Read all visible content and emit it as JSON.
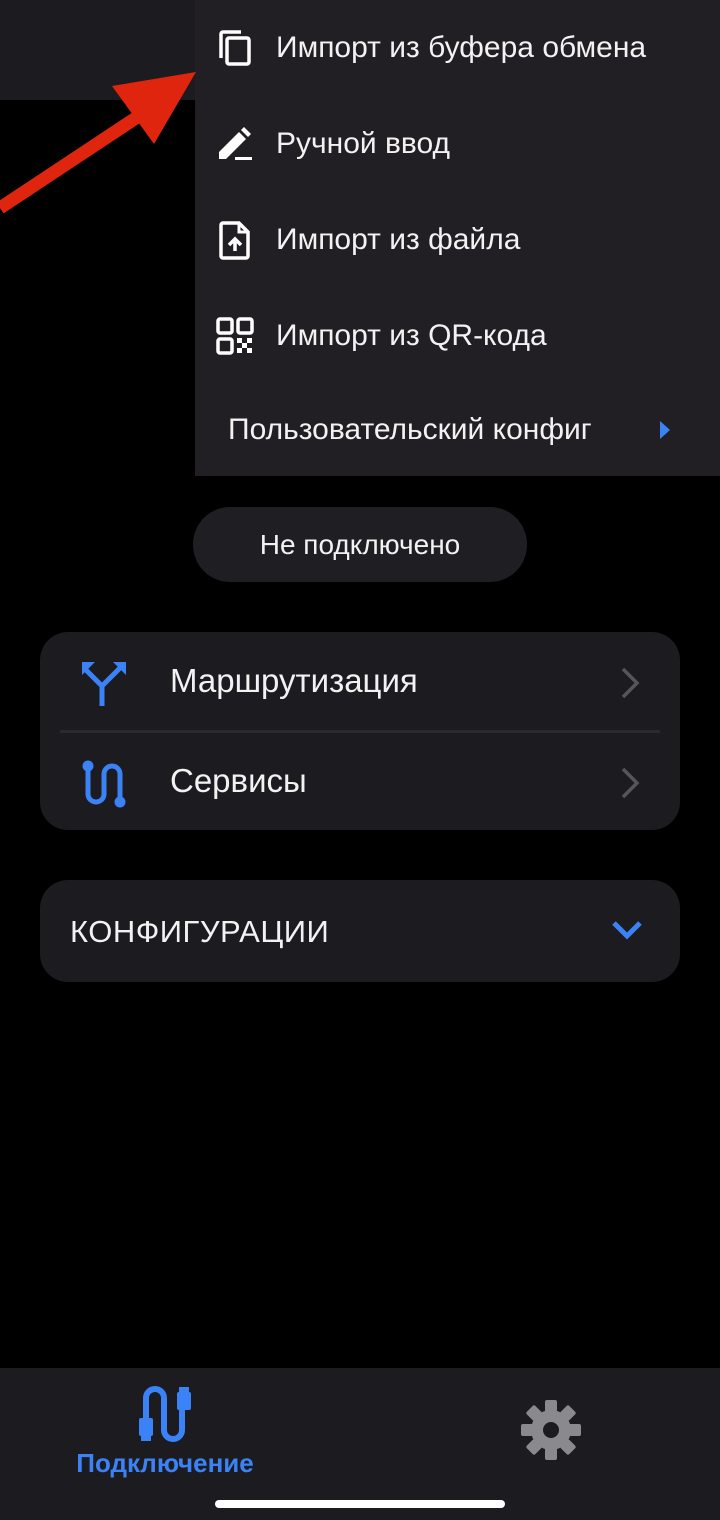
{
  "colors": {
    "accent": "#3b82f6",
    "annotation_arrow": "#e0250f",
    "background": "#000000",
    "surface": "#1c1b1f",
    "menu_surface": "#211f23",
    "inactive_icon": "#8a8a8e"
  },
  "menu": {
    "items": [
      {
        "label": "Импорт из буфера обмена",
        "icon": "copy-icon"
      },
      {
        "label": "Ручной ввод",
        "icon": "edit-pencil-icon"
      },
      {
        "label": "Импорт из файла",
        "icon": "file-upload-icon"
      },
      {
        "label": "Импорт из QR-кода",
        "icon": "qr-code-icon"
      },
      {
        "label": "Пользовательский конфиг",
        "icon": "chevron-right-icon"
      }
    ]
  },
  "status": {
    "label": "Не подключено"
  },
  "routes_card": {
    "rows": [
      {
        "label": "Маршрутизация",
        "icon": "routing-split-icon"
      },
      {
        "label": "Сервисы",
        "icon": "services-path-icon"
      }
    ]
  },
  "configs": {
    "title": "КОНФИГУРАЦИИ",
    "icon": "chevron-down-icon"
  },
  "bottom_nav": {
    "connect_label": "Подключение",
    "connect_icon": "connection-cable-icon",
    "settings_icon": "gear-icon"
  }
}
